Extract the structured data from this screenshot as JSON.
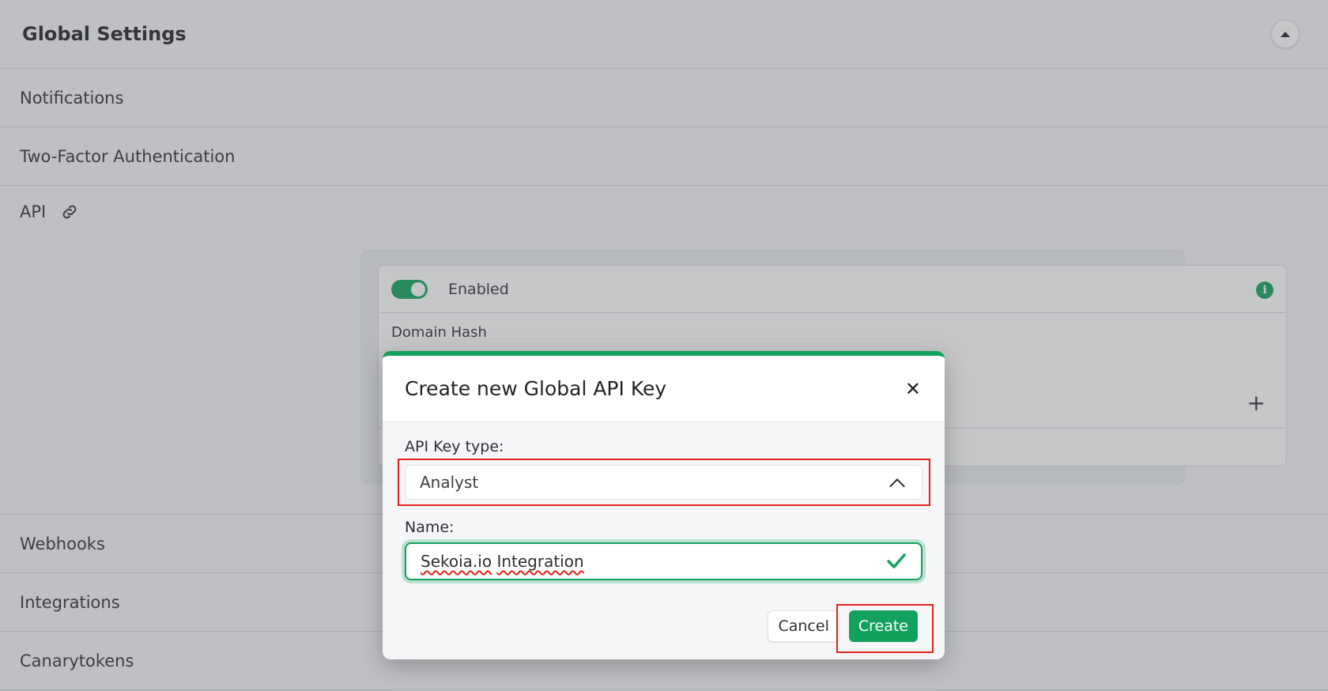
{
  "header": {
    "title": "Global Settings"
  },
  "sections": {
    "notifications": "Notifications",
    "two_factor": "Two-Factor Authentication",
    "api": "API",
    "webhooks": "Webhooks",
    "integrations": "Integrations",
    "canarytokens": "Canarytokens"
  },
  "api_card": {
    "enabled_label": "Enabled",
    "toggle_on": true,
    "domain_hash_label": "Domain Hash"
  },
  "modal": {
    "title": "Create new Global API Key",
    "api_key_type_label": "API Key type:",
    "api_key_type_value": "Analyst",
    "name_label": "Name:",
    "name_value_part1": "Sekoia.io",
    "name_value_part2": "Integration",
    "cancel_label": "Cancel",
    "create_label": "Create"
  },
  "colors": {
    "accent": "#12a25d",
    "highlight": "#e2231a"
  }
}
